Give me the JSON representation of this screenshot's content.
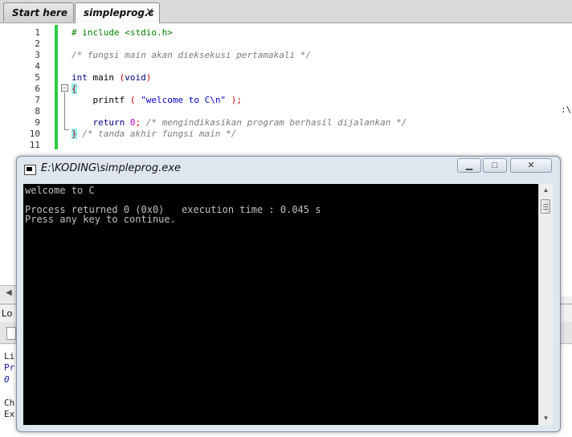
{
  "tabs": [
    {
      "label": "Start here"
    },
    {
      "label": "simpleprog.c",
      "close": "✕"
    }
  ],
  "editor": {
    "line_numbers": [
      "1",
      "2",
      "3",
      "4",
      "5",
      "6",
      "7",
      "8",
      "9",
      "10",
      "11"
    ],
    "lines": {
      "l1": "# include <stdio.h>",
      "l3": "/* fungsi main akan dieksekusi pertamakali */",
      "l5_kw": "int",
      "l5_name": " main ",
      "l5_paren_open": "(",
      "l5_void": "void",
      "l5_paren_close": ")",
      "l6_brace": "{",
      "l7_indent": "    ",
      "l7_func": "printf ",
      "l7_paren_open": "( ",
      "l7_string": "\"welcome to C\\n\"",
      "l7_end": " );",
      "l9_indent": "    ",
      "l9_kw": "return",
      "l9_num": " 0",
      "l9_semi": ";",
      "l9_comment": " /* mengindikasikan program berhasil dijalankan */",
      "l10_brace": "}",
      "l10_comment": " /* tanda akhir fungsi main */"
    },
    "fold_symbol": "−",
    "scroll_left": "◀"
  },
  "logs": {
    "tab_label": "Lo",
    "lines": [
      "Li",
      "Pr",
      "0",
      "",
      "Ch",
      "Ex"
    ],
    "right_fragment": ":\\"
  },
  "console": {
    "title": "E:\\KODING\\simpleprog.exe",
    "buttons": {
      "minimize": "▁",
      "maximize": "□",
      "close": "✕"
    },
    "output": [
      "welcome to C",
      "",
      "Process returned 0 (0x0)   execution time : 0.045 s",
      "Press any key to continue."
    ],
    "scroll_up": "▲",
    "scroll_down": "▼"
  },
  "colors": {
    "changebar": "#2ecc40",
    "brace_match": "#8ff0f0",
    "console_bg": "#000000",
    "console_fg": "#c0c0c0"
  }
}
